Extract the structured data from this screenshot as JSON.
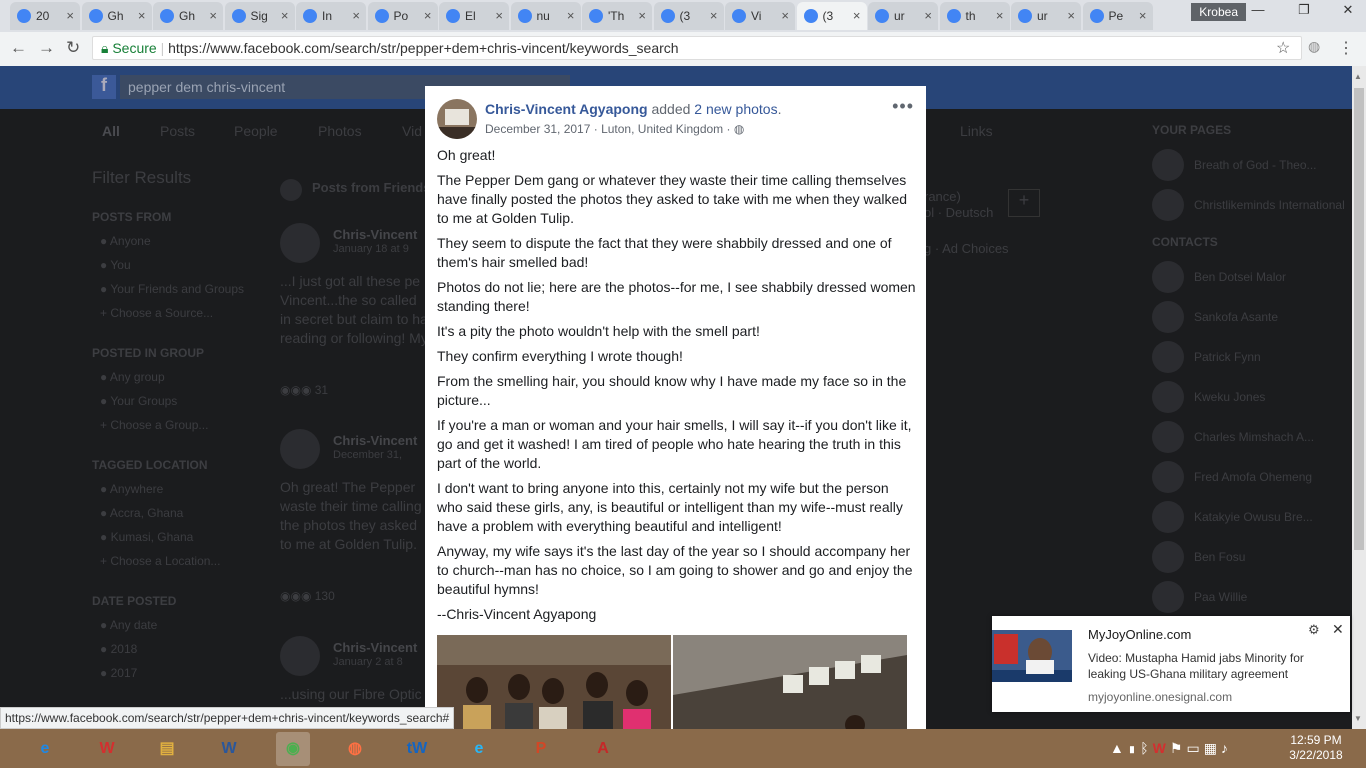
{
  "browser": {
    "tabs": [
      {
        "label": "20",
        "icon": "google-icon"
      },
      {
        "label": "Gh",
        "icon": "ghana-flag-icon"
      },
      {
        "label": "Gh",
        "icon": "google-icon"
      },
      {
        "label": "Sig",
        "icon": "google-icon"
      },
      {
        "label": "In",
        "icon": "gmail-icon"
      },
      {
        "label": "Po",
        "icon": "globe-icon"
      },
      {
        "label": "El",
        "icon": "youtube-icon"
      },
      {
        "label": "nu",
        "icon": "google-icon"
      },
      {
        "label": "'Th",
        "icon": "ghana-flag-icon"
      },
      {
        "label": "(3",
        "icon": "facebook-icon"
      },
      {
        "label": "Vi",
        "icon": "video-icon"
      },
      {
        "label": "(3",
        "icon": "facebook-icon"
      },
      {
        "label": "ur",
        "icon": "google-icon"
      },
      {
        "label": "th",
        "icon": "document-icon"
      },
      {
        "label": "ur",
        "icon": "google-icon"
      },
      {
        "label": "Pe",
        "icon": "think-icon"
      }
    ],
    "active_tab": 11,
    "user": "Krobea",
    "secure_label": "Secure",
    "url": "https://www.facebook.com/search/str/pepper+dem+chris-vincent/keywords_search"
  },
  "facebook": {
    "search_value": "pepper dem chris-vincent",
    "nav_tabs": [
      "All",
      "Posts",
      "People",
      "Photos",
      "Vid",
      "Links"
    ],
    "filter_title": "Filter Results",
    "section_title": "Posts from Friends",
    "filters": [
      {
        "heading": "POSTS FROM",
        "items": [
          "Anyone",
          "You",
          "Your Friends and Groups",
          "Choose a Source..."
        ]
      },
      {
        "heading": "POSTED IN GROUP",
        "items": [
          "Any group",
          "Your Groups",
          "Choose a Group..."
        ]
      },
      {
        "heading": "TAGGED LOCATION",
        "items": [
          "Anywhere",
          "Accra, Ghana",
          "Kumasi, Ghana",
          "Choose a Location..."
        ]
      },
      {
        "heading": "DATE POSTED",
        "items": [
          "Any date",
          "2018",
          "2017"
        ]
      }
    ],
    "bg_posts": [
      {
        "name": "Chris-Vincent",
        "date": "January 18 at 9",
        "text": [
          "...I just got all these pe",
          "Vincent...the so called",
          "in secret but claim to ha",
          "reading or following! My"
        ],
        "reactions": "31"
      },
      {
        "name": "Chris-Vincent",
        "date": "December 31,",
        "text": [
          "Oh great! The Pepper",
          "waste their time calling",
          "the photos they asked",
          "to me at Golden Tulip."
        ],
        "reactions": "130"
      },
      {
        "name": "Chris-Vincent",
        "date": "January 2 at 8",
        "text": [
          "...using our Fibre Optic"
        ],
        "reactions": ""
      }
    ],
    "lang_text": [
      "rance)",
      "ol · Deutsch"
    ],
    "ad_choices": "g · Ad Choices",
    "right_heading": "YOUR PAGES",
    "pages": [
      "Breath of God - Theo...",
      "Christlikeminds International"
    ],
    "contacts_heading": "CONTACTS",
    "contacts": [
      "Ben Dotsei Malor",
      "Sankofa Asante",
      "Patrick Fynn",
      "Kweku Jones",
      "Charles Mimshach A...",
      "Fred Amofa Ohemeng",
      "Katakyie Owusu Bre...",
      "Ben Fosu",
      "Paa Willie"
    ]
  },
  "post": {
    "author": "Chris-Vincent Agyapong",
    "action": "added",
    "count_label": "2 new photos",
    "action_end": ".",
    "date": "December 31, 2017",
    "location": "Luton, United Kingdom",
    "privacy_icon": "globe-icon",
    "more_label": "•••",
    "paragraphs": [
      "Oh great!",
      "The Pepper Dem gang or whatever they waste their time calling themselves have finally posted the photos they asked to take with me when they walked to me at Golden Tulip.",
      "They seem to dispute the fact that they were shabbily dressed and one of them's hair smelled bad!",
      "Photos do not lie; here are the photos--for me, I see shabbily dressed women standing there!",
      "It's a pity the photo wouldn't help with the smell part!",
      "They confirm everything I wrote though!",
      "From the smelling hair, you should know why I have made my face so in the picture...",
      "If you're a man or woman and your hair smells, I will say it--if you don't like it, go and get it washed! I am tired of people who hate hearing the truth in this part of the world.",
      "I don't want to bring anyone into this, certainly not my wife but the person who said these girls, any, is beautiful or intelligent than my wife--must really have a problem with everything beautiful and intelligent!",
      "Anyway, my wife says it's the last day of the year so I should accompany her to church--man has no choice, so I am going to shower and go and enjoy the beautiful hymns!",
      "--Chris-Vincent Agyapong"
    ]
  },
  "notification": {
    "source": "MyJoyOnline.com",
    "message": "Video: Mustapha Hamid jabs Minority for leaking US-Ghana military agreement",
    "url": "myjoyonline.onesignal.com"
  },
  "status_url": "https://www.facebook.com/search/str/pepper+dem+chris-vincent/keywords_search#",
  "taskbar": {
    "apps": [
      {
        "name": "internet-explorer-icon",
        "glyph": "e",
        "color": "#1e88e5"
      },
      {
        "name": "winrar-icon",
        "glyph": "W",
        "color": "#d32f2f"
      },
      {
        "name": "file-explorer-icon",
        "glyph": "▤",
        "color": "#e0b040"
      },
      {
        "name": "word-icon",
        "glyph": "W",
        "color": "#2b579a"
      },
      {
        "name": "chrome-icon",
        "glyph": "◉",
        "color": "#4caf50"
      },
      {
        "name": "firefox-icon",
        "glyph": "◍",
        "color": "#ff7043"
      },
      {
        "name": "twinkle-icon",
        "glyph": "tW",
        "color": "#1565c0"
      },
      {
        "name": "edge-icon",
        "glyph": "e",
        "color": "#29b6f6"
      },
      {
        "name": "powerpoint-icon",
        "glyph": "P",
        "color": "#d24726"
      },
      {
        "name": "acrobat-icon",
        "glyph": "A",
        "color": "#c62828"
      }
    ],
    "time": "12:59 PM",
    "date": "3/22/2018"
  }
}
